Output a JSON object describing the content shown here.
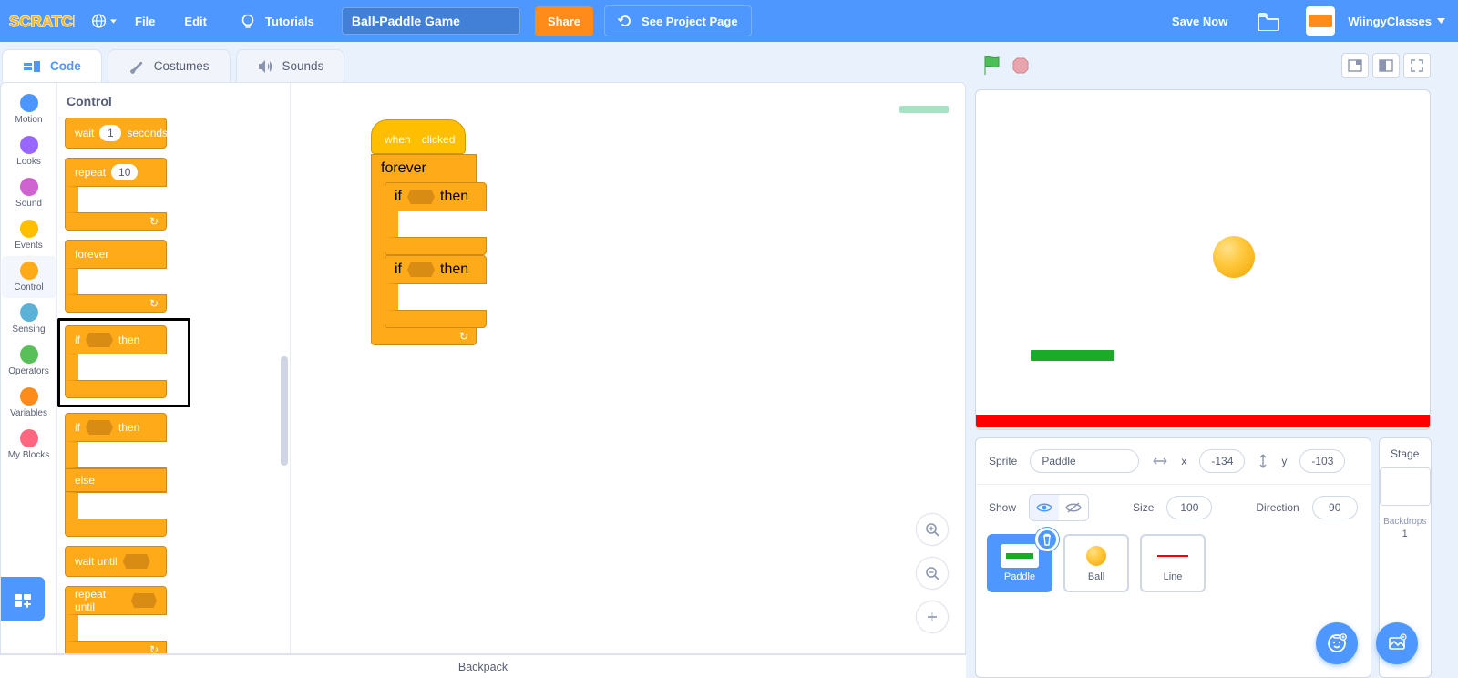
{
  "menubar": {
    "file": "File",
    "edit": "Edit",
    "tutorials": "Tutorials",
    "project_title": "Ball-Paddle Game",
    "share": "Share",
    "see_project_page": "See Project Page",
    "save_now": "Save Now",
    "username": "WiingyClasses"
  },
  "tabs": {
    "code": "Code",
    "costumes": "Costumes",
    "sounds": "Sounds"
  },
  "categories": [
    {
      "name": "Motion",
      "color": "#4c97ff"
    },
    {
      "name": "Looks",
      "color": "#9966ff"
    },
    {
      "name": "Sound",
      "color": "#cf63cf"
    },
    {
      "name": "Events",
      "color": "#ffbf00"
    },
    {
      "name": "Control",
      "color": "#ffab19"
    },
    {
      "name": "Sensing",
      "color": "#5cb1d6"
    },
    {
      "name": "Operators",
      "color": "#59c059"
    },
    {
      "name": "Variables",
      "color": "#ff8c1a"
    },
    {
      "name": "My Blocks",
      "color": "#ff6680"
    }
  ],
  "active_category_index": 4,
  "palette": {
    "header": "Control",
    "wait_label": "wait",
    "wait_value": "1",
    "seconds_label": "seconds",
    "repeat_label": "repeat",
    "repeat_value": "10",
    "forever_label": "forever",
    "if_label": "if",
    "then_label": "then",
    "else_label": "else",
    "wait_until_label": "wait until",
    "repeat_until_label": "repeat until"
  },
  "script": {
    "hat_when": "when",
    "hat_clicked": "clicked",
    "forever": "forever",
    "if": "if",
    "then": "then"
  },
  "sprite_info": {
    "sprite_label": "Sprite",
    "sprite_name": "Paddle",
    "x_label": "x",
    "x_value": "-134",
    "y_label": "y",
    "y_value": "-103",
    "show_label": "Show",
    "size_label": "Size",
    "size_value": "100",
    "direction_label": "Direction",
    "direction_value": "90"
  },
  "sprites": [
    {
      "name": "Paddle",
      "selected": true
    },
    {
      "name": "Ball",
      "selected": false
    },
    {
      "name": "Line",
      "selected": false
    }
  ],
  "stage_panel": {
    "title": "Stage",
    "backdrops_label": "Backdrops",
    "backdrops_count": "1"
  },
  "backpack": "Backpack"
}
